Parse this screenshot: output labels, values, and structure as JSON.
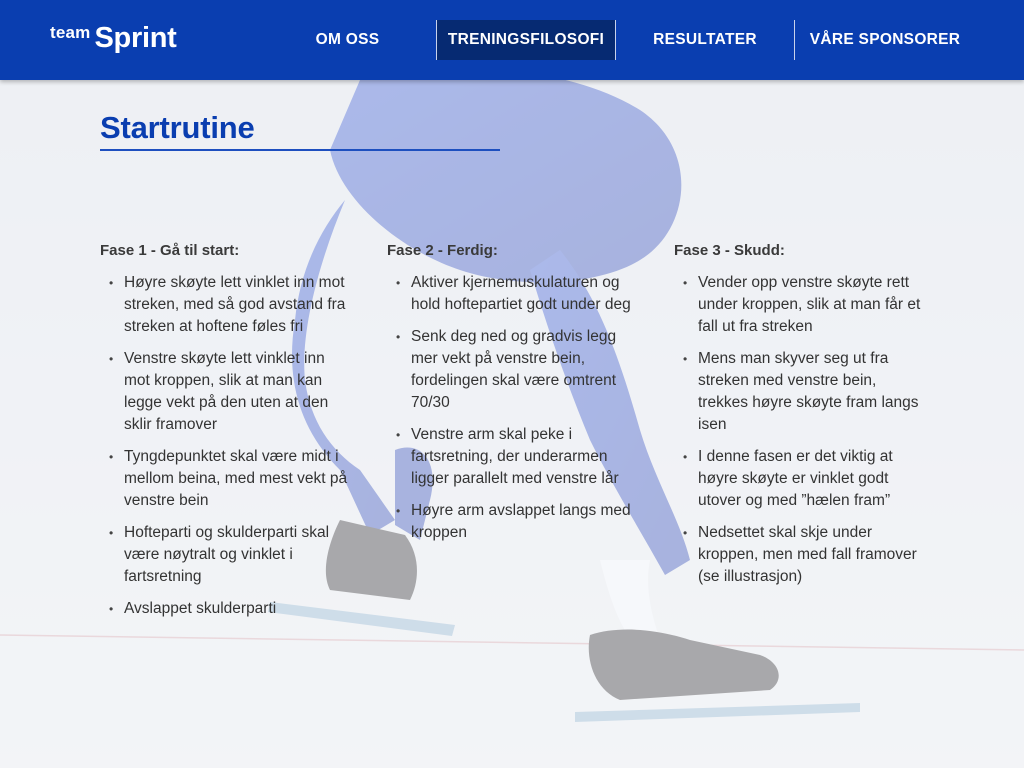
{
  "header": {
    "logo_small": "team",
    "logo_big": "Sprint",
    "nav": [
      {
        "label": "OM OSS"
      },
      {
        "label": "TRENINGSFILOSOFI",
        "active": true
      },
      {
        "label": "RESULTATER"
      },
      {
        "label": "VÅRE SPONSORER"
      }
    ]
  },
  "colors": {
    "brand_blue": "#0a3eb0",
    "active_nav": "#062a72",
    "text": "#333333"
  },
  "page": {
    "title": "Startrutine",
    "phases": [
      {
        "heading": "Fase 1 - Gå til start:",
        "items": [
          "Høyre skøyte lett vinklet inn mot streken, med så god avstand fra streken at hoftene føles fri",
          "Venstre skøyte lett vinklet inn mot kroppen, slik at man kan legge vekt på den uten at den sklir framover",
          "Tyngdepunktet skal være midt i mellom beina, med mest vekt på venstre bein",
          "Hofteparti og skulderparti skal være nøytralt og vinklet i fartsretning",
          "Avslappet skulderparti"
        ]
      },
      {
        "heading": "Fase 2 - Ferdig:",
        "items": [
          "Aktiver kjernemuskulaturen og hold hoftepartiet godt under deg",
          "Senk deg ned og gradvis legg mer vekt på venstre bein, fordelingen skal være omtrent 70/30",
          "Venstre arm skal peke i fartsretning, der underarmen ligger parallelt med venstre lår",
          "Høyre arm avslappet langs med kroppen"
        ]
      },
      {
        "heading": "Fase 3 - Skudd:",
        "items": [
          "Vender opp venstre skøyte rett under kroppen, slik at man får et fall ut fra streken",
          "Mens man skyver seg ut fra streken med venstre bein, trekkes høyre skøyte fram langs isen",
          "I denne fasen er det viktig at høyre skøyte er vinklet godt utover og med ”hælen fram”",
          "Nedsettet skal skje under kroppen, men med fall framover (se illustrasjon)"
        ]
      }
    ]
  },
  "background": {
    "icon": "speed-skater-illustration"
  }
}
